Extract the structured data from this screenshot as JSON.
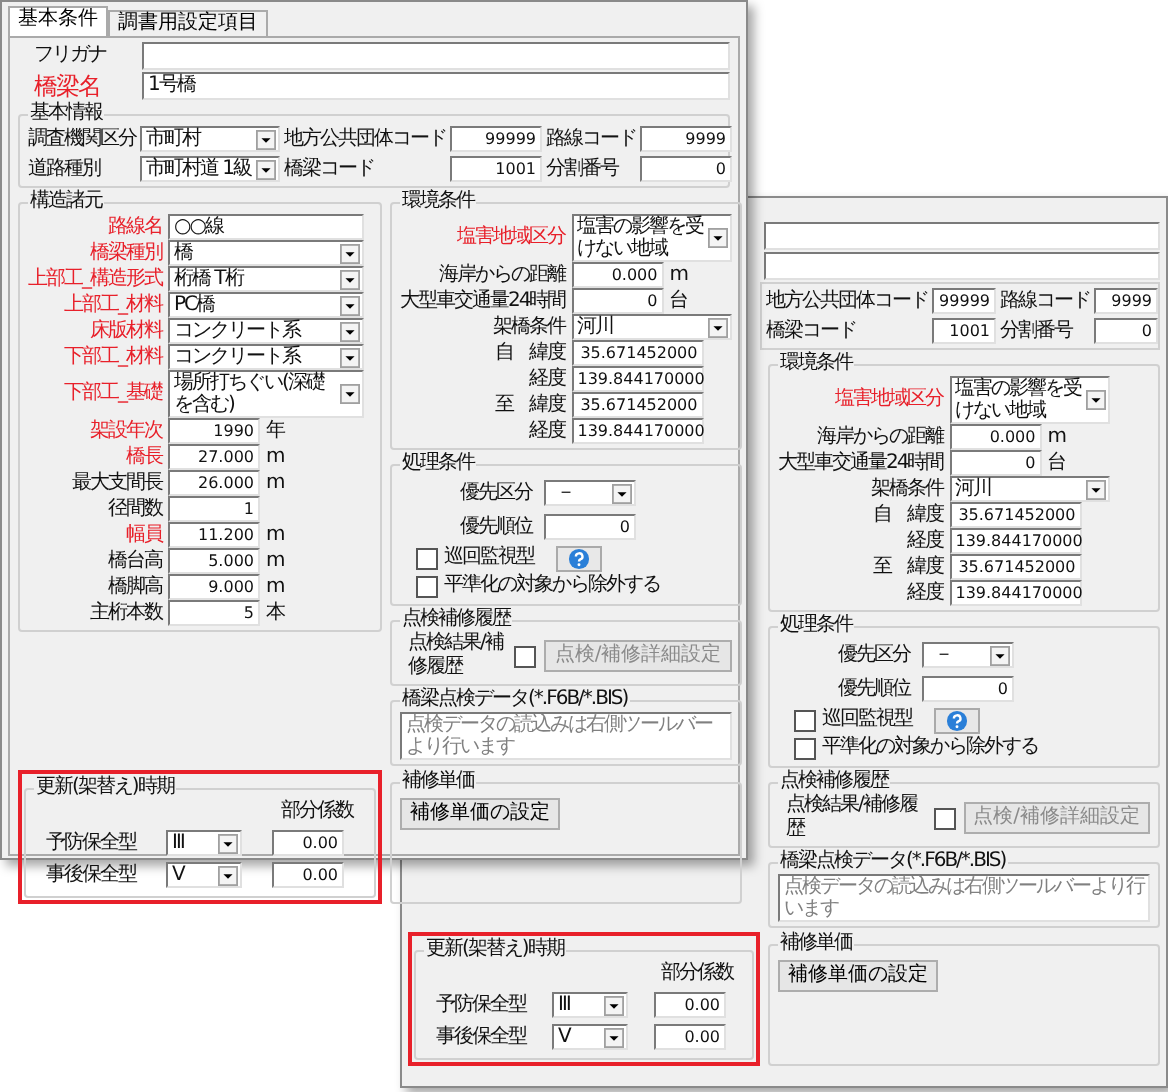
{
  "front_window": {
    "tabs": [
      {
        "label": "基本条件",
        "selected": true
      },
      {
        "label": "調書用設定項目",
        "selected": false
      }
    ],
    "name_fields": [
      {
        "label": "フリガナ",
        "required": false
      },
      {
        "label": "橋梁名",
        "value": "1号橋",
        "required": true
      }
    ],
    "basic_info": {
      "title": "基本情報",
      "rows": [
        [
          {
            "label": "調査機関区分",
            "value": "市町村",
            "kind": "combo"
          },
          {
            "label": "地方公共団体コード",
            "value": "99999",
            "kind": "number"
          },
          {
            "label": "路線コード",
            "value": "9999",
            "kind": "number"
          }
        ],
        [
          {
            "label": "道路種別",
            "value": "市町村道 1級",
            "kind": "combo"
          },
          {
            "label": "橋梁コード",
            "value": "1001",
            "kind": "number"
          },
          {
            "label": "分割番号",
            "value": "0",
            "kind": "number"
          }
        ]
      ]
    },
    "structure": {
      "title": "構造諸元",
      "rows": [
        {
          "label": "路線名",
          "value": "○○線",
          "kind": "text",
          "required": true
        },
        {
          "label": "橋梁種別",
          "value": "橋",
          "kind": "combo",
          "required": true
        },
        {
          "label": "上部工_構造形式",
          "value": "桁橋 T桁",
          "kind": "combo",
          "required": true
        },
        {
          "label": "上部工_材料",
          "value": "PC橋",
          "kind": "combo",
          "required": true
        },
        {
          "label": "床版材料",
          "value": "コンクリート系",
          "kind": "combo",
          "required": true
        },
        {
          "label": "下部工_材料",
          "value": "コンクリート系",
          "kind": "combo",
          "required": true
        },
        {
          "label": "下部工_基礎",
          "value": "場所打ちぐい(深礎を含む)",
          "kind": "combo",
          "required": true
        },
        {
          "label": "架設年次",
          "value": "1990",
          "unit": "年",
          "kind": "number",
          "required": true
        },
        {
          "label": "橋長",
          "value": "27.000",
          "unit": "m",
          "kind": "number",
          "required": true
        },
        {
          "label": "最大支間長",
          "value": "26.000",
          "unit": "m",
          "kind": "number",
          "required": false
        },
        {
          "label": "径間数",
          "value": "1",
          "kind": "number",
          "required": false
        },
        {
          "label": "幅員",
          "value": "11.200",
          "unit": "m",
          "kind": "number",
          "required": true
        },
        {
          "label": "橋台高",
          "value": "5.000",
          "unit": "m",
          "kind": "number",
          "required": false
        },
        {
          "label": "橋脚高",
          "value": "9.000",
          "unit": "m",
          "kind": "number",
          "required": false
        },
        {
          "label": "主桁本数",
          "value": "5",
          "unit": "本",
          "kind": "number",
          "required": false
        }
      ]
    },
    "environment": {
      "title": "環境条件",
      "rows": [
        {
          "label": "塩害地域区分",
          "value": "塩害の影響を受けない地域",
          "kind": "combo",
          "required": true
        },
        {
          "label": "海岸からの距離",
          "value": "0.000",
          "unit": "m",
          "kind": "number",
          "required": false
        },
        {
          "label": "大型車交通量24時間",
          "value": "0",
          "unit": "台",
          "kind": "number",
          "required": false
        },
        {
          "label": "架橋条件",
          "value": "河川",
          "kind": "combo",
          "required": false
        },
        {
          "prefix": "自",
          "label": "緯度",
          "value": "35.671452000",
          "kind": "coord",
          "required": false
        },
        {
          "label": "経度",
          "value": "139.844170000",
          "kind": "coord",
          "required": false
        },
        {
          "prefix": "至",
          "label": "緯度",
          "value": "35.671452000",
          "kind": "coord",
          "required": false
        },
        {
          "label": "経度",
          "value": "139.844170000",
          "kind": "coord",
          "required": false
        }
      ]
    },
    "processing": {
      "title": "処理条件",
      "rows": [
        {
          "label": "優先区分",
          "value": "－",
          "kind": "combo"
        },
        {
          "label": "優先順位",
          "value": "0",
          "kind": "number"
        }
      ],
      "checks": [
        {
          "label": "巡回監視型",
          "checked": false,
          "help": true
        },
        {
          "label": "平準化の対象から除外する",
          "checked": false,
          "help": false
        }
      ]
    },
    "history": {
      "title": "点検補修履歴",
      "label": "点検結果/補修履歴",
      "checked": false,
      "button": "点検/補修詳細設定",
      "button_disabled": true
    },
    "inspection_data": {
      "title": "橋梁点検データ(*.F6B/*.BIS)",
      "placeholder": "点検データの読込みは右側ツールバーより行います"
    },
    "repair_cost": {
      "title": "補修単価",
      "button": "補修単価の設定"
    },
    "renewal": {
      "title": "更新(架替え)時期",
      "column_heading": "部分係数",
      "highlighted": true,
      "rows": [
        {
          "label": "予防保全型",
          "grade": "Ⅲ",
          "factor": "0.00"
        },
        {
          "label": "事後保全型",
          "grade": "Ⅴ",
          "factor": "0.00"
        }
      ]
    }
  },
  "back_window": {
    "basic_info": {
      "rows": [
        [
          {
            "label": "地方公共団体コード",
            "value": "99999",
            "kind": "number"
          },
          {
            "label": "路線コード",
            "value": "9999",
            "kind": "number"
          }
        ],
        [
          {
            "label": "橋梁コード",
            "value": "1001",
            "kind": "number"
          },
          {
            "label": "分割番号",
            "value": "0",
            "kind": "number"
          }
        ]
      ]
    },
    "environment": {
      "title": "環境条件",
      "rows": [
        {
          "label": "塩害地域区分",
          "value": "塩害の影響を受けない地域",
          "kind": "combo",
          "required": true
        },
        {
          "label": "海岸からの距離",
          "value": "0.000",
          "unit": "m",
          "kind": "number",
          "required": false
        },
        {
          "label": "大型車交通量24時間",
          "value": "0",
          "unit": "台",
          "kind": "number",
          "required": false
        },
        {
          "label": "架橋条件",
          "value": "河川",
          "kind": "combo",
          "required": false
        },
        {
          "prefix": "自",
          "label": "緯度",
          "value": "35.671452000",
          "kind": "coord",
          "required": false
        },
        {
          "label": "経度",
          "value": "139.844170000",
          "kind": "coord",
          "required": false
        },
        {
          "prefix": "至",
          "label": "緯度",
          "value": "35.671452000",
          "kind": "coord",
          "required": false
        },
        {
          "label": "経度",
          "value": "139.844170000",
          "kind": "coord",
          "required": false
        }
      ]
    },
    "processing": {
      "title": "処理条件",
      "rows": [
        {
          "label": "優先区分",
          "value": "－",
          "kind": "combo"
        },
        {
          "label": "優先順位",
          "value": "0",
          "kind": "number"
        }
      ],
      "checks": [
        {
          "label": "巡回監視型",
          "checked": false,
          "help": true
        },
        {
          "label": "平準化の対象から除外する",
          "checked": false,
          "help": false
        }
      ]
    },
    "history": {
      "title": "点検補修履歴",
      "label": "点検結果/補修履歴",
      "checked": false,
      "button": "点検/補修詳細設定",
      "button_disabled": true
    },
    "inspection_data": {
      "title": "橋梁点検データ(*.F6B/*.BIS)",
      "placeholder": "点検データの読込みは右側ツールバーより行います"
    },
    "repair_cost": {
      "title": "補修単価",
      "button": "補修単価の設定"
    },
    "renewal": {
      "title": "更新(架替え)時期",
      "column_heading": "部分係数",
      "highlighted": true,
      "rows": [
        {
          "label": "予防保全型",
          "grade": "Ⅲ",
          "factor": "0.00"
        },
        {
          "label": "事後保全型",
          "grade": "Ⅴ",
          "factor": "0.00"
        }
      ]
    }
  }
}
